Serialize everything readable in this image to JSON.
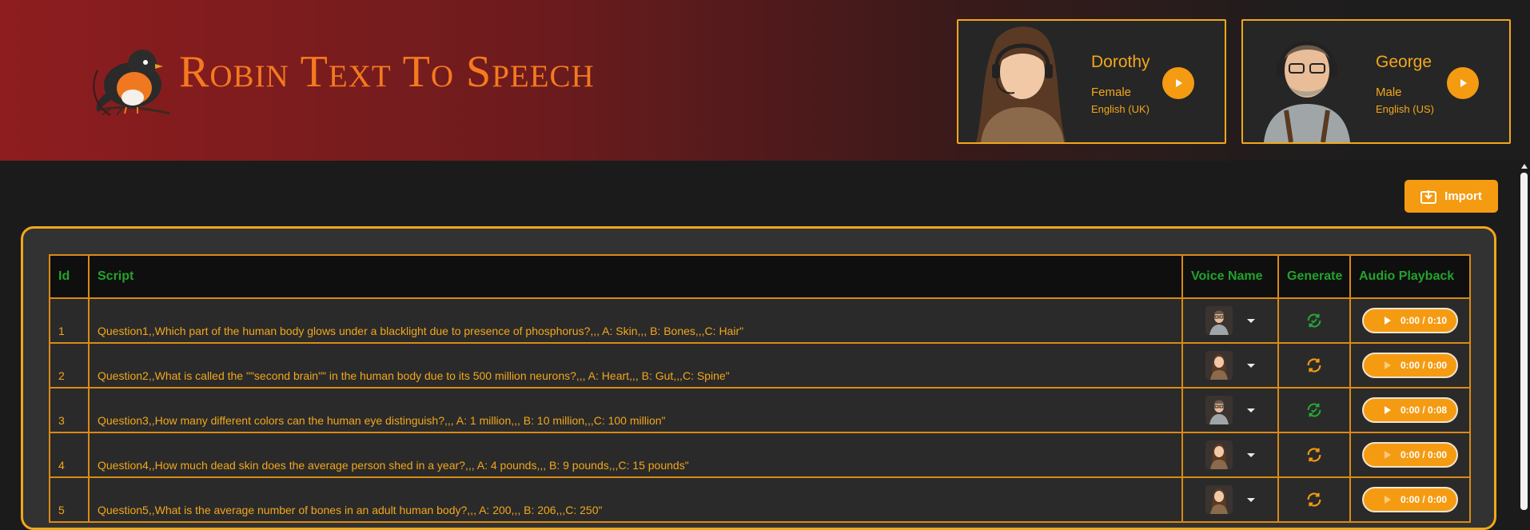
{
  "app": {
    "title": "Robin Text To Speech"
  },
  "voices": [
    {
      "name": "Dorothy",
      "gender": "Female",
      "language": "English (UK)"
    },
    {
      "name": "George",
      "gender": "Male",
      "language": "English (US)"
    }
  ],
  "toolbar": {
    "import_label": "Import"
  },
  "table": {
    "columns": [
      "Id",
      "Script",
      "Voice Name",
      "Generate",
      "Audio Playback"
    ],
    "rows": [
      {
        "id": "1",
        "script": "Question1,,Which part of the human body glows under a blacklight due to presence of phosphorus?,,, A: Skin,,, B: Bones,,,C: Hair\"",
        "voice": "male",
        "generate": "done",
        "time": "0:00 / 0:10"
      },
      {
        "id": "2",
        "script": "Question2,,What is called the \"\"second brain\"\" in the human body due to its 500 million neurons?,,, A: Heart,,, B: Gut,,,C: Spine\"",
        "voice": "female",
        "generate": "pending",
        "time": "0:00 / 0:00"
      },
      {
        "id": "3",
        "script": "Question3,,How many different colors can the human eye distinguish?,,, A: 1 million,,, B: 10 million,,,C: 100 million\"",
        "voice": "male",
        "generate": "done",
        "time": "0:00 / 0:08"
      },
      {
        "id": "4",
        "script": "Question4,,How much dead skin does the average person shed in a year?,,, A: 4 pounds,,, B: 9 pounds,,,C: 15 pounds\"",
        "voice": "female",
        "generate": "pending",
        "time": "0:00 / 0:00"
      },
      {
        "id": "5",
        "script": "Question5,,What is the average number of bones in an adult human body?,,, A: 200,,, B: 206,,,C: 250\"",
        "voice": "female",
        "generate": "pending",
        "time": "0:00 / 0:00"
      }
    ]
  },
  "colors": {
    "accent": "#f59b12",
    "header_green": "#23a32a",
    "done_green": "#27a83a",
    "border_orange": "#d98a16"
  }
}
